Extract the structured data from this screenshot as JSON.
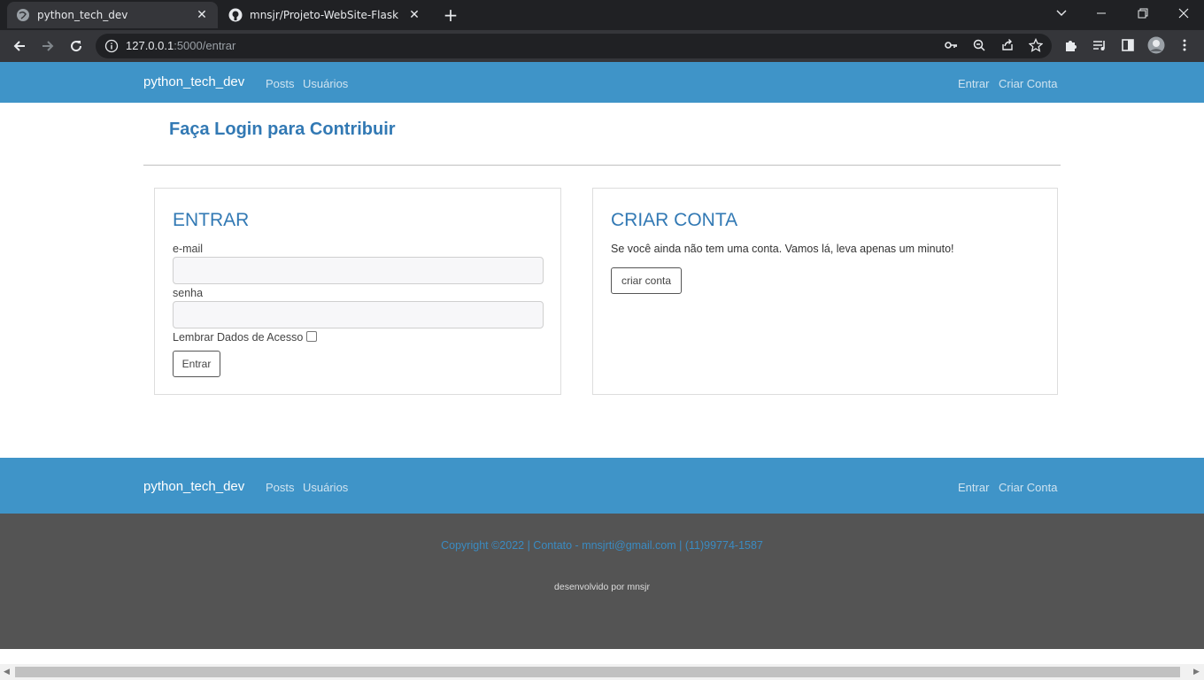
{
  "browser": {
    "tabs": [
      {
        "title": "python_tech_dev",
        "active": true
      },
      {
        "title": "mnsjr/Projeto-WebSite-Flask",
        "active": false
      }
    ],
    "url_host": "127.0.0.1",
    "url_path": ":5000/entrar"
  },
  "navbar": {
    "brand": "python_tech_dev",
    "links": [
      "Posts",
      "Usuários"
    ],
    "right_links": [
      "Entrar",
      "Criar Conta"
    ]
  },
  "page": {
    "title": "Faça Login para Contribuir"
  },
  "login": {
    "heading": "ENTRAR",
    "email_label": "e-mail",
    "email_value": "",
    "password_label": "senha",
    "password_value": "",
    "remember_label": "Lembrar Dados de Acesso",
    "remember_checked": false,
    "submit_label": "Entrar"
  },
  "signup": {
    "heading": "CRIAR CONTA",
    "text": "Se você ainda não tem uma conta. Vamos lá, leva apenas um minuto!",
    "button_label": "criar conta"
  },
  "footer": {
    "brand": "python_tech_dev",
    "links": [
      "Posts",
      "Usuários"
    ],
    "right_links": [
      "Entrar",
      "Criar Conta"
    ],
    "copyright": "Copyright ©2022 | Contato - mnsjrti@gmail.com | (11)99774-1587",
    "developed_by": "desenvolvido por mnsjr"
  },
  "colors": {
    "navbar_bg": "#3f94c8",
    "accent": "#3279b4",
    "footer_bg": "#545454"
  }
}
